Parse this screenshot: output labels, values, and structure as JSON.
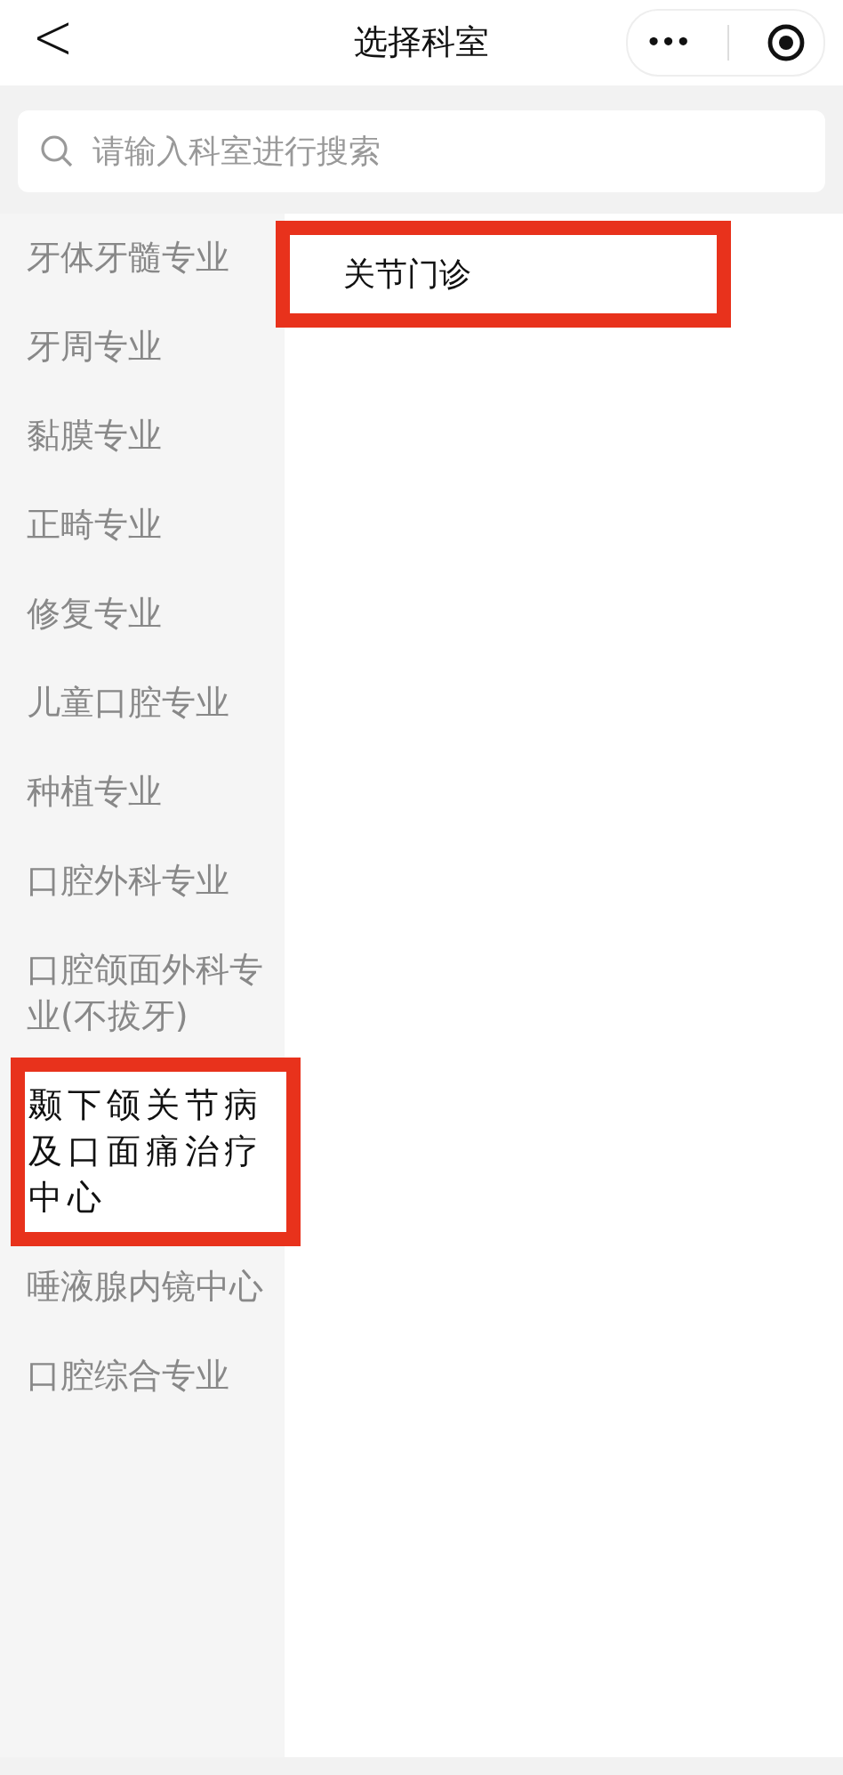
{
  "nav_bar": {
    "back": "<",
    "title": "选择科室",
    "more": "•••"
  },
  "search": {
    "placeholder": "请输入科室进行搜索"
  },
  "departments": [
    {
      "label": "牙体牙髓专业",
      "selected": false,
      "highlighted": false
    },
    {
      "label": "牙周专业",
      "selected": false,
      "highlighted": false
    },
    {
      "label": "黏膜专业",
      "selected": false,
      "highlighted": false
    },
    {
      "label": "正畸专业",
      "selected": false,
      "highlighted": false
    },
    {
      "label": "修复专业",
      "selected": false,
      "highlighted": false
    },
    {
      "label": "儿童口腔专业",
      "selected": false,
      "highlighted": false
    },
    {
      "label": "种植专业",
      "selected": false,
      "highlighted": false
    },
    {
      "label": "口腔外科专业",
      "selected": false,
      "highlighted": false
    },
    {
      "label": "口腔颌面外科专业(不拔牙)",
      "selected": false,
      "highlighted": false
    },
    {
      "label": "颞下颌关节病及口面痛治疗中心",
      "selected": true,
      "highlighted": true
    },
    {
      "label": "唾液腺内镜中心",
      "selected": false,
      "highlighted": false
    },
    {
      "label": "口腔综合专业",
      "selected": false,
      "highlighted": false
    }
  ],
  "clinics": [
    {
      "label": "关节门诊",
      "highlighted": true
    }
  ]
}
